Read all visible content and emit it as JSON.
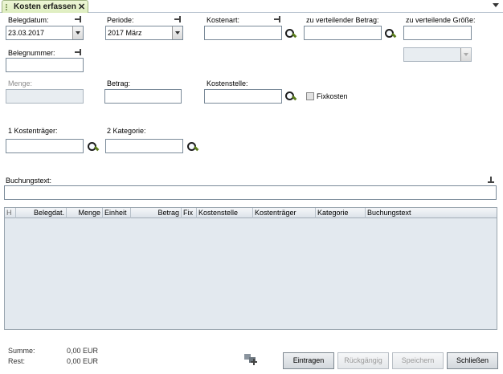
{
  "tab": {
    "label": "Kosten erfassen",
    "close": "✕"
  },
  "form": {
    "belegdatum": {
      "label": "Belegdatum:",
      "value": "23.03.2017"
    },
    "periode": {
      "label": "Periode:",
      "value": "2017  März"
    },
    "kostenart": {
      "label": "Kostenart:",
      "value": ""
    },
    "zu_verteilender_betrag": {
      "label": "zu verteilender Betrag:",
      "value": ""
    },
    "zu_verteilende_groesse": {
      "label": "zu verteilende Größe:",
      "value": "",
      "combo_value": ""
    },
    "belegnummer": {
      "label": "Belegnummer:",
      "value": ""
    },
    "menge": {
      "label": "Menge:",
      "value": ""
    },
    "betrag": {
      "label": "Betrag:",
      "value": ""
    },
    "kostenstelle": {
      "label": "Kostenstelle:",
      "value": ""
    },
    "fixkosten": {
      "label": "Fixkosten",
      "checked": false
    },
    "kostentraeger": {
      "label": "1 Kostenträger:",
      "value": ""
    },
    "kategorie": {
      "label": "2 Kategorie:",
      "value": ""
    },
    "buchungstext": {
      "label": "Buchungstext:",
      "value": ""
    }
  },
  "table": {
    "columns": [
      "H",
      "Belegdat.",
      "Menge",
      "Einheit",
      "Betrag",
      "Fix",
      "Kostenstelle",
      "Kostenträger",
      "Kategorie",
      "Buchungstext"
    ],
    "rows": []
  },
  "summary": {
    "summe_label": "Summe:",
    "summe_value": "0,00 EUR",
    "rest_label": "Rest:",
    "rest_value": "0,00 EUR"
  },
  "buttons": {
    "eintragen": "Eintragen",
    "rueckgaengig": "Rückgängig",
    "speichern": "Speichern",
    "schliessen": "Schließen"
  },
  "icons": {
    "tab_close": "close-icon",
    "pin": "pin-icon",
    "search": "search-icon",
    "dropdown": "chevron-down-icon",
    "group": "group-add-icon"
  },
  "colors": {
    "tab_bg": "#dfeec0",
    "grid_bg": "#e3e9ef",
    "disabled_field": "#e8edf1"
  }
}
